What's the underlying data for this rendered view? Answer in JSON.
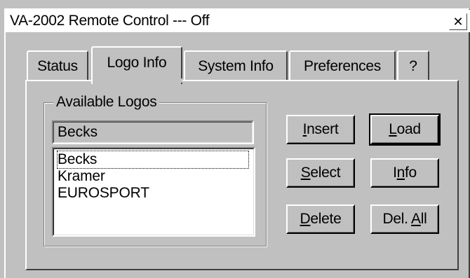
{
  "window": {
    "title": "VA-2002 Remote Control --- Off",
    "close_glyph": "✕"
  },
  "tabs": [
    {
      "label": "Status",
      "active": false
    },
    {
      "label": "Logo Info",
      "active": true
    },
    {
      "label": "System Info",
      "active": false
    },
    {
      "label": "Preferences",
      "active": false
    },
    {
      "label": "?",
      "active": false
    }
  ],
  "logos": {
    "group_label": "Available Logos",
    "current_value": "Becks",
    "items": [
      "Becks",
      "Kramer",
      "EUROSPORT"
    ],
    "selected_item": "Becks"
  },
  "buttons": {
    "insert": {
      "mnemonic": "I",
      "rest": "nsert"
    },
    "load": {
      "mnemonic": "L",
      "rest": "oad"
    },
    "select": {
      "mnemonic": "S",
      "rest": "elect"
    },
    "info": {
      "pre": "I",
      "mnemonic": "n",
      "rest": "fo"
    },
    "delete": {
      "mnemonic": "D",
      "rest": "elete"
    },
    "del_all": {
      "pre": "Del. ",
      "mnemonic": "A",
      "rest": "ll"
    }
  }
}
